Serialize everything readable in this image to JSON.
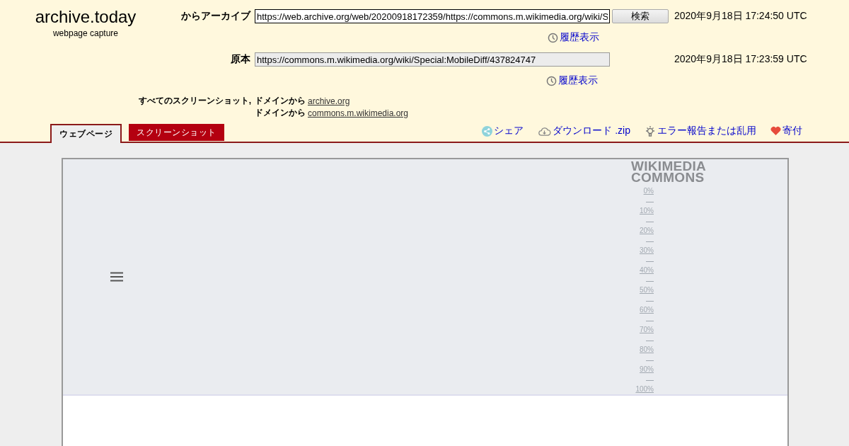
{
  "site": {
    "title": "archive.today",
    "subtitle": "webpage capture"
  },
  "archived": {
    "label": "からアーカイブ",
    "url": "https://web.archive.org/web/20200918172359/https://commons.m.wikimedia.org/wiki/S",
    "button": "検索",
    "date": "2020年9月18日 17:24:50 UTC",
    "history": "履歴表示"
  },
  "original": {
    "label": "原本",
    "url": "https://commons.m.wikimedia.org/wiki/Special:MobileDiff/437824747",
    "date": "2020年9月18日 17:23:59 UTC",
    "history": "履歴表示"
  },
  "all_screenshots": {
    "label": "すべてのスクリーンショット,",
    "domains": [
      {
        "prefix": "ドメインから",
        "link": "archive.org"
      },
      {
        "prefix": "ドメインから",
        "link": "commons.m.wikimedia.org"
      }
    ]
  },
  "tabs": [
    {
      "label": "ウェブページ",
      "selected": true
    },
    {
      "label": "スクリーンショット",
      "selected": false
    }
  ],
  "actions": [
    {
      "kind": "share",
      "label": "シェア"
    },
    {
      "kind": "download",
      "label": "ダウンロード .zip"
    },
    {
      "kind": "report",
      "label": "エラー報告または乱用"
    },
    {
      "kind": "donate",
      "label": "寄付"
    }
  ],
  "page": {
    "logo_lines": [
      "WIKIMEDIA",
      "COMMONS"
    ],
    "progress_links": [
      "0%",
      "10%",
      "20%",
      "30%",
      "40%",
      "50%",
      "60%",
      "70%",
      "80%",
      "90%",
      "100%"
    ]
  }
}
